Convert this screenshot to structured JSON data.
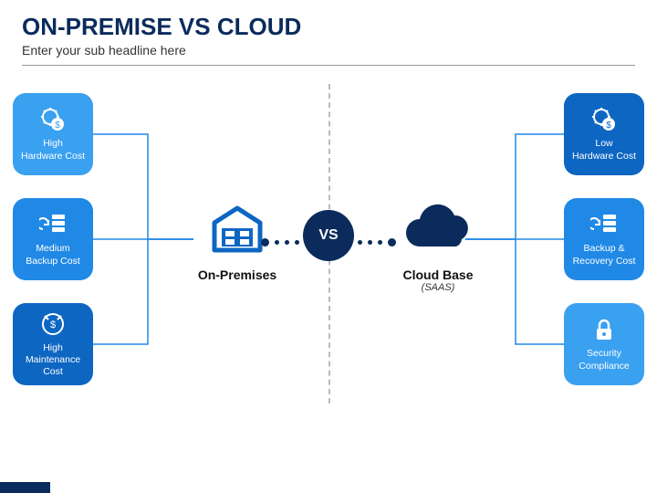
{
  "header": {
    "title": "ON-PREMISE VS CLOUD",
    "subtitle": "Enter your sub headline here"
  },
  "vs_label": "VS",
  "left": {
    "center_label": "On-Premises",
    "cards": [
      {
        "label": "High\nHardware Cost",
        "shade": "light"
      },
      {
        "label": "Medium\nBackup Cost",
        "shade": "med"
      },
      {
        "label": "High\nMaintenance\nCost",
        "shade": "dark"
      }
    ]
  },
  "right": {
    "center_label": "Cloud Base",
    "center_sub": "(SAAS)",
    "cards": [
      {
        "label": "Low\nHardware Cost",
        "shade": "dark"
      },
      {
        "label": "Backup &\nRecovery Cost",
        "shade": "med"
      },
      {
        "label": "Security\nCompliance",
        "shade": "light"
      }
    ]
  }
}
